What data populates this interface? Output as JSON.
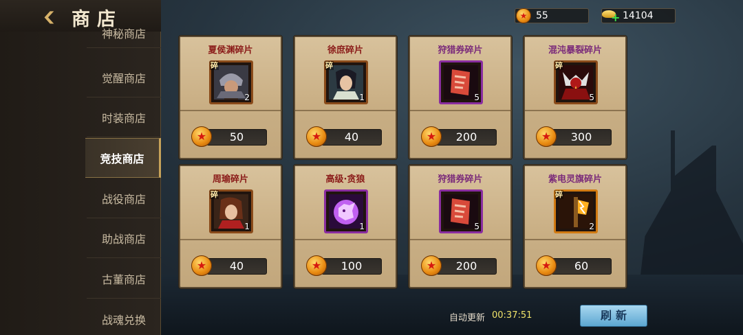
{
  "header": {
    "title": "商店"
  },
  "sidebar": {
    "items": [
      {
        "label": "神秘商店"
      },
      {
        "label": "觉醒商店"
      },
      {
        "label": "时装商店"
      },
      {
        "label": "竞技商店"
      },
      {
        "label": "战役商店"
      },
      {
        "label": "助战商店"
      },
      {
        "label": "古董商店"
      },
      {
        "label": "战魂兑换"
      }
    ],
    "active_index": 3
  },
  "currency": {
    "coins": "55",
    "gold": "14104"
  },
  "shop": {
    "items": [
      {
        "name": "夏侯渊碎片",
        "fragment_tag": "碎",
        "count": "2",
        "price": "50",
        "name_color": "red",
        "frame": "bronze",
        "icon": "warrior-helmet-portrait"
      },
      {
        "name": "徐庶碎片",
        "fragment_tag": "碎",
        "count": "1",
        "price": "40",
        "name_color": "red",
        "frame": "bronze",
        "icon": "scholar-portrait"
      },
      {
        "name": "狩猎券碎片",
        "fragment_tag": "",
        "count": "5",
        "price": "200",
        "name_color": "purple",
        "frame": "purple",
        "icon": "ticket-scroll"
      },
      {
        "name": "混沌暴裂碎片",
        "fragment_tag": "碎",
        "count": "5",
        "price": "300",
        "name_color": "purple",
        "frame": "bronze",
        "icon": "demon-portrait"
      },
      {
        "name": "周瑜碎片",
        "fragment_tag": "碎",
        "count": "1",
        "price": "40",
        "name_color": "red",
        "frame": "bronze",
        "icon": "general-portrait"
      },
      {
        "name": "高级·贪狼",
        "fragment_tag": "",
        "count": "1",
        "price": "100",
        "name_color": "red",
        "frame": "purple",
        "icon": "wolf-spirit"
      },
      {
        "name": "狩猎券碎片",
        "fragment_tag": "",
        "count": "5",
        "price": "200",
        "name_color": "purple",
        "frame": "purple",
        "icon": "ticket-scroll"
      },
      {
        "name": "紫电灵旗碎片",
        "fragment_tag": "碎",
        "count": "2",
        "price": "60",
        "name_color": "purple",
        "frame": "orange",
        "icon": "lightning-banner"
      }
    ]
  },
  "footer": {
    "auto_refresh_label": "自动更新",
    "timer": "00:37:51",
    "refresh_label": "刷新"
  },
  "colors": {
    "card_bg": "#c8ad82",
    "accent_gold": "#c8a35a",
    "timer": "#f0e36a",
    "refresh_button": "#7dbfe2"
  }
}
